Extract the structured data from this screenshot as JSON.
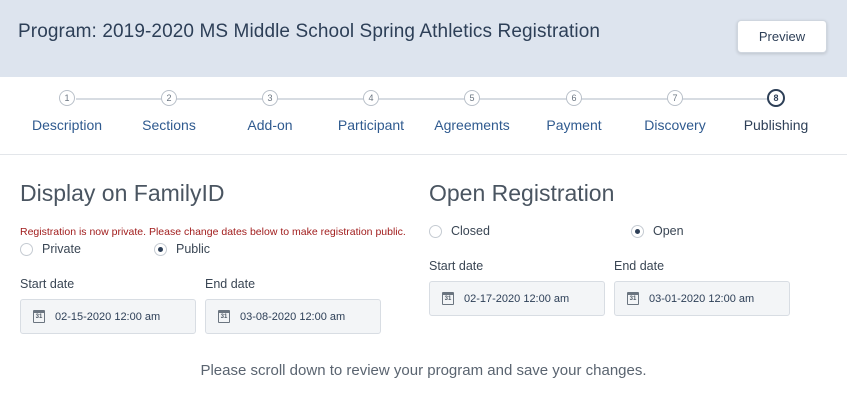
{
  "header": {
    "title": "Program: 2019-2020 MS Middle School Spring Athletics Registration",
    "preview_label": "Preview"
  },
  "steps": [
    {
      "number": "1",
      "label": "Description"
    },
    {
      "number": "2",
      "label": "Sections"
    },
    {
      "number": "3",
      "label": "Add-on"
    },
    {
      "number": "4",
      "label": "Participant"
    },
    {
      "number": "5",
      "label": "Agreements"
    },
    {
      "number": "6",
      "label": "Payment"
    },
    {
      "number": "7",
      "label": "Discovery"
    },
    {
      "number": "8",
      "label": "Publishing"
    }
  ],
  "display": {
    "title": "Display on FamilyID",
    "notice": "Registration is now private. Please change dates below to make registration public.",
    "options": [
      {
        "label": "Private",
        "selected": false
      },
      {
        "label": "Public",
        "selected": true
      }
    ],
    "start_label": "Start date",
    "start_value": "02-15-2020 12:00 am",
    "end_label": "End date",
    "end_value": "03-08-2020 12:00 am"
  },
  "registration": {
    "title": "Open Registration",
    "options": [
      {
        "label": "Closed",
        "selected": false
      },
      {
        "label": "Open",
        "selected": true
      }
    ],
    "start_label": "Start date",
    "start_value": "02-17-2020 12:00 am",
    "end_label": "End date",
    "end_value": "03-01-2020 12:00 am"
  },
  "calendar_icon_text": "31",
  "footer_message": "Please scroll down to review your program and save your changes."
}
